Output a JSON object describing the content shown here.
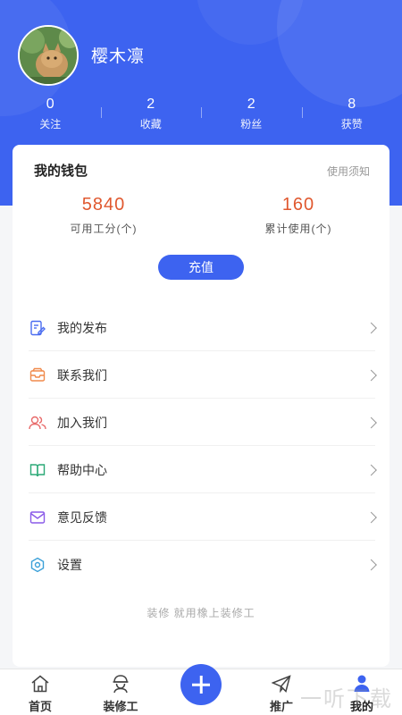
{
  "profile": {
    "username": "樱木凛",
    "stats": [
      {
        "value": "0",
        "label": "关注"
      },
      {
        "value": "2",
        "label": "收藏"
      },
      {
        "value": "2",
        "label": "粉丝"
      },
      {
        "value": "8",
        "label": "获赞"
      }
    ]
  },
  "wallet": {
    "title": "我的钱包",
    "notice": "使用须知",
    "available_points": {
      "value": "5840",
      "label": "可用工分(个)"
    },
    "total_used": {
      "value": "160",
      "label": "累计使用(个)"
    },
    "recharge_label": "充值"
  },
  "menu": [
    {
      "label": "我的发布",
      "icon": "edit-doc-icon",
      "color": "#4a6cf0"
    },
    {
      "label": "联系我们",
      "icon": "mail-tray-icon",
      "color": "#f08a4b"
    },
    {
      "label": "加入我们",
      "icon": "users-icon",
      "color": "#e86a6a"
    },
    {
      "label": "帮助中心",
      "icon": "book-icon",
      "color": "#2aa876"
    },
    {
      "label": "意见反馈",
      "icon": "envelope-icon",
      "color": "#8a5ae8"
    },
    {
      "label": "设置",
      "icon": "gear-icon",
      "color": "#3aa0d8"
    }
  ],
  "slogan": "装修 就用橡上装修工",
  "tabs": [
    {
      "label": "首页",
      "icon": "home-icon"
    },
    {
      "label": "装修工",
      "icon": "worker-icon"
    },
    {
      "label": "",
      "icon": "plus-icon"
    },
    {
      "label": "推广",
      "icon": "paper-plane-icon"
    },
    {
      "label": "我的",
      "icon": "person-icon"
    }
  ],
  "watermark": "一听下载",
  "colors": {
    "primary": "#3d63f0",
    "accent_orange": "#e0582f"
  }
}
